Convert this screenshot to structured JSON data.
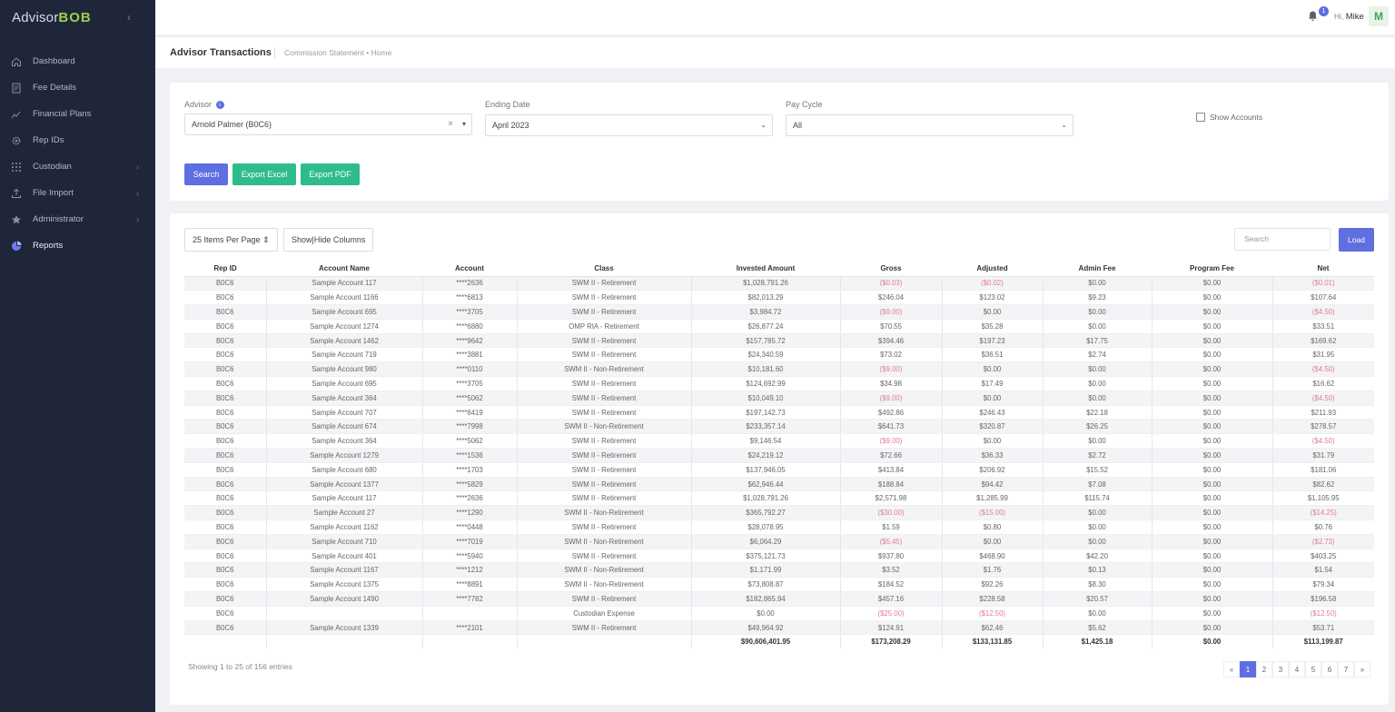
{
  "app": {
    "logo_text": "Advisor",
    "logo_bold": "BOB",
    "collapse_glyph": "‹"
  },
  "sidebar": {
    "items": [
      {
        "label": "Dashboard",
        "icon": "home-icon",
        "chevron": false
      },
      {
        "label": "Fee Details",
        "icon": "document-icon",
        "chevron": false
      },
      {
        "label": "Financial Plans",
        "icon": "chart-line-icon",
        "chevron": false
      },
      {
        "label": "Rep IDs",
        "icon": "gear-icon",
        "chevron": false
      },
      {
        "label": "Custodian",
        "icon": "grid-icon",
        "chevron": true
      },
      {
        "label": "File Import",
        "icon": "upload-icon",
        "chevron": true
      },
      {
        "label": "Administrator",
        "icon": "star-icon",
        "chevron": true
      },
      {
        "label": "Reports",
        "icon": "pie-chart-icon",
        "chevron": false,
        "active": true
      }
    ]
  },
  "topbar": {
    "notification_count": "1",
    "greeting": "Hi,",
    "user_name": "Mike",
    "avatar_letter": "M"
  },
  "page": {
    "title": "Advisor Transactions",
    "breadcrumb": "Commission Statement • Home"
  },
  "filters": {
    "advisor_label": "Advisor",
    "advisor_info": "i",
    "advisor_value": "Arnold Palmer (B0C6)",
    "clear_glyph": "×",
    "ending_date_label": "Ending Date",
    "ending_date_value": "April 2023",
    "pay_cycle_label": "Pay Cycle",
    "pay_cycle_value": "All",
    "show_accounts_label": "Show Accounts",
    "search_label": "Search",
    "export_excel_label": "Export Excel",
    "export_pdf_label": "Export PDF"
  },
  "table_tools": {
    "per_page_label": "25 Items Per Page",
    "show_hide_label": "Show|Hide Columns",
    "search_placeholder": "Search",
    "load_label": "Load"
  },
  "table": {
    "headers": [
      "Rep ID",
      "Account Name",
      "Account",
      "Class",
      "Invested Amount",
      "Gross",
      "Adjusted",
      "Admin Fee",
      "Program Fee",
      "Net"
    ],
    "rows": [
      [
        "B0C6",
        "Sample Account 117",
        "****2636",
        "SWM II - Retirement",
        "$1,028,791.26",
        "($0.03)",
        "($0.02)",
        "$0.00",
        "$0.00",
        "($0.01)"
      ],
      [
        "B0C6",
        "Sample Account 1166",
        "****6813",
        "SWM II - Retirement",
        "$82,013.29",
        "$246.04",
        "$123.02",
        "$9.23",
        "$0.00",
        "$107.64"
      ],
      [
        "B0C6",
        "Sample Account 695",
        "****3705",
        "SWM II - Retirement",
        "$3,984.72",
        "($9.00)",
        "$0.00",
        "$0.00",
        "$0.00",
        "($4.50)"
      ],
      [
        "B0C6",
        "Sample Account 1274",
        "****6880",
        "OMP RIA - Retirement",
        "$26,877.24",
        "$70.55",
        "$35.28",
        "$0.00",
        "$0.00",
        "$33.51"
      ],
      [
        "B0C6",
        "Sample Account 1462",
        "****9642",
        "SWM II - Retirement",
        "$157,785.72",
        "$394.46",
        "$197.23",
        "$17.75",
        "$0.00",
        "$169.62"
      ],
      [
        "B0C6",
        "Sample Account 719",
        "****3881",
        "SWM II - Retirement",
        "$24,340.59",
        "$73.02",
        "$36.51",
        "$2.74",
        "$0.00",
        "$31.95"
      ],
      [
        "B0C6",
        "Sample Account 980",
        "****0110",
        "SWM II - Non-Retirement",
        "$10,181.60",
        "($9.00)",
        "$0.00",
        "$0.00",
        "$0.00",
        "($4.50)"
      ],
      [
        "B0C6",
        "Sample Account 695",
        "****3705",
        "SWM II - Retirement",
        "$124,692.99",
        "$34.98",
        "$17.49",
        "$0.00",
        "$0.00",
        "$16.62"
      ],
      [
        "B0C6",
        "Sample Account 364",
        "****5062",
        "SWM II - Retirement",
        "$10,049.10",
        "($9.00)",
        "$0.00",
        "$0.00",
        "$0.00",
        "($4.50)"
      ],
      [
        "B0C6",
        "Sample Account 707",
        "****8419",
        "SWM II - Retirement",
        "$197,142.73",
        "$492.86",
        "$246.43",
        "$22.18",
        "$0.00",
        "$211.93"
      ],
      [
        "B0C6",
        "Sample Account 674",
        "****7998",
        "SWM II - Non-Retirement",
        "$233,357.14",
        "$641.73",
        "$320.87",
        "$26.25",
        "$0.00",
        "$278.57"
      ],
      [
        "B0C6",
        "Sample Account 364",
        "****5062",
        "SWM II - Retirement",
        "$9,146.54",
        "($9.00)",
        "$0.00",
        "$0.00",
        "$0.00",
        "($4.50)"
      ],
      [
        "B0C6",
        "Sample Account 1279",
        "****1536",
        "SWM II - Retirement",
        "$24,219.12",
        "$72.66",
        "$36.33",
        "$2.72",
        "$0.00",
        "$31.79"
      ],
      [
        "B0C6",
        "Sample Account 680",
        "****1703",
        "SWM II - Retirement",
        "$137,946.05",
        "$413.84",
        "$206.92",
        "$15.52",
        "$0.00",
        "$181.06"
      ],
      [
        "B0C6",
        "Sample Account 1377",
        "****5829",
        "SWM II - Retirement",
        "$62,946.44",
        "$188.84",
        "$94.42",
        "$7.08",
        "$0.00",
        "$82.62"
      ],
      [
        "B0C6",
        "Sample Account 117",
        "****2636",
        "SWM II - Retirement",
        "$1,028,791.26",
        "$2,571.98",
        "$1,285.99",
        "$115.74",
        "$0.00",
        "$1,105.95"
      ],
      [
        "B0C6",
        "Sample Account 27",
        "****1290",
        "SWM II - Non-Retirement",
        "$365,792.27",
        "($30.00)",
        "($15.00)",
        "$0.00",
        "$0.00",
        "($14.25)"
      ],
      [
        "B0C6",
        "Sample Account 1162",
        "****0448",
        "SWM II - Retirement",
        "$28,078.95",
        "$1.59",
        "$0.80",
        "$0.00",
        "$0.00",
        "$0.76"
      ],
      [
        "B0C6",
        "Sample Account 710",
        "****7019",
        "SWM II - Non-Retirement",
        "$6,064.29",
        "($5.45)",
        "$0.00",
        "$0.00",
        "$0.00",
        "($2.73)"
      ],
      [
        "B0C6",
        "Sample Account 401",
        "****5940",
        "SWM II - Retirement",
        "$375,121.73",
        "$937.80",
        "$468.90",
        "$42.20",
        "$0.00",
        "$403.25"
      ],
      [
        "B0C6",
        "Sample Account 1167",
        "****1212",
        "SWM II - Non-Retirement",
        "$1,171.99",
        "$3.52",
        "$1.76",
        "$0.13",
        "$0.00",
        "$1.54"
      ],
      [
        "B0C6",
        "Sample Account 1375",
        "****8891",
        "SWM II - Non-Retirement",
        "$73,808.87",
        "$184.52",
        "$92.26",
        "$8.30",
        "$0.00",
        "$79.34"
      ],
      [
        "B0C6",
        "Sample Account 1490",
        "****7782",
        "SWM II - Retirement",
        "$182,865.94",
        "$457.16",
        "$228.58",
        "$20.57",
        "$0.00",
        "$196.58"
      ],
      [
        "B0C6",
        "",
        "",
        "Custodian Expense",
        "$0.00",
        "($25.00)",
        "($12.50)",
        "$0.00",
        "$0.00",
        "($12.50)"
      ],
      [
        "B0C6",
        "Sample Account 1339",
        "****2101",
        "SWM II - Retirement",
        "$49,964.92",
        "$124.91",
        "$62.46",
        "$5.62",
        "$0.00",
        "$53.71"
      ]
    ],
    "totals": [
      "",
      "",
      "",
      "",
      "$90,606,401.95",
      "$173,208.29",
      "$133,131.85",
      "$1,425.18",
      "$0.00",
      "$113,199.87"
    ]
  },
  "footer": {
    "showing_text": "Showing 1 to 25 of 156 entries",
    "pages": [
      "«",
      "1",
      "2",
      "3",
      "4",
      "5",
      "6",
      "7",
      "»"
    ],
    "active_page": "1"
  },
  "colors": {
    "sidebar_bg": "#20263a",
    "accent": "#5f6ee0",
    "green": "#2fbc8c",
    "negative": "#e07a9a"
  }
}
